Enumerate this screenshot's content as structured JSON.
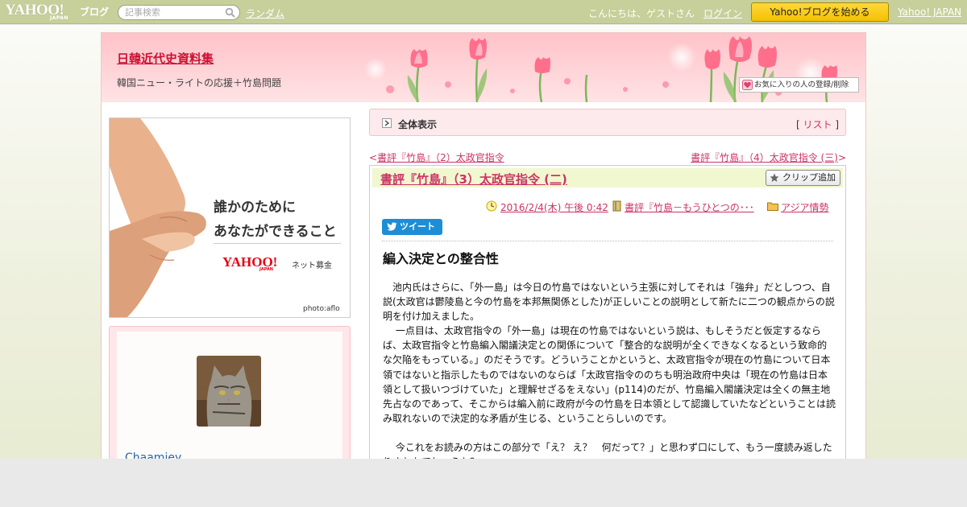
{
  "topbar": {
    "logo_text": "YAHOO!",
    "logo_sub": "JAPAN",
    "logo_blog": "ブログ",
    "search_placeholder": "記事検索",
    "random_link": "ランダム",
    "greeting": "こんにちは、ゲストさん",
    "login_link": "ログイン",
    "start_blog_button": "Yahoo!ブログを始める",
    "yahoo_japan_link": "Yahoo! JAPAN"
  },
  "header": {
    "blog_title": "日韓近代史資料集",
    "blog_subtitle": "韓国ニュー・ライトの応援＋竹島問題",
    "fav_button": "お気に入りの人の登録/削除"
  },
  "ad": {
    "line1": "誰かのために",
    "line2": "あなたができること",
    "brand": "YAHOO!",
    "brand_sub": "JAPAN",
    "service": "ネット募金",
    "credit": "photo:aflo"
  },
  "profile": {
    "name": "Chaamiey"
  },
  "main": {
    "all_view_label": "全体表示",
    "list_bracket_open": "[ ",
    "list_link": "リスト",
    "list_bracket_close": " ]",
    "prev_arrow": "<",
    "prev_link": "書評『竹島』（2）太政官指令",
    "next_link": "書評『竹島』（4）太政官指令 (三)",
    "next_arrow": ">"
  },
  "article": {
    "title": "書評『竹島』（3）太政官指令 (二)",
    "clip_button": "クリップ追加",
    "date": "2016/2/4(木) 午後 0:42",
    "book_link": "書評『竹島－もうひとつの･･･",
    "category_link": "アジア情勢",
    "tweet_button": "ツイート",
    "section_heading": "編入決定との整合性",
    "paragraphs": [
      "　池内氏はさらに、「外一島」は今日の竹島ではないという主張に対してそれは「強弁」だとしつつ、自説(太政官は鬱陵島と今の竹島を本邦無関係とした)が正しいことの説明として新たに二つの観点からの説明を付け加えました。",
      "　 一点目は、太政官指令の「外一島」は現在の竹島ではないという説は、もしそうだと仮定するならば、太政官指令と竹島編入閣議決定との関係について「整合的な説明が全くできなくなるという致命的な欠陥をもっている。」のだそうです。どういうことかというと、太政官指令が現在の竹島について日本領ではないと指示したものではないのならば「太政官指令ののちも明治政府中央は「現在の竹島は日本領として扱いつづけていた」と理解せざるをえない」(p114)のだが、竹島編入閣議決定は全くの無主地先占なのであって、そこからは編入前に政府が今の竹島を日本領として認識していたなどということは読み取れないので決定的な矛盾が生じる、ということらしいのです。",
      "",
      "　 今これをお読みの方はこの部分で「え？ え？　何だって？」と思わず口にして、もう一度読み返したりされたでしょうか？"
    ]
  },
  "colors": {
    "topbar": "#c7cf9a",
    "accent_link": "#cc3366",
    "title_red": "#cc1133",
    "button_yellow": "#f5c000",
    "twitter_blue": "#1d8ed6"
  }
}
